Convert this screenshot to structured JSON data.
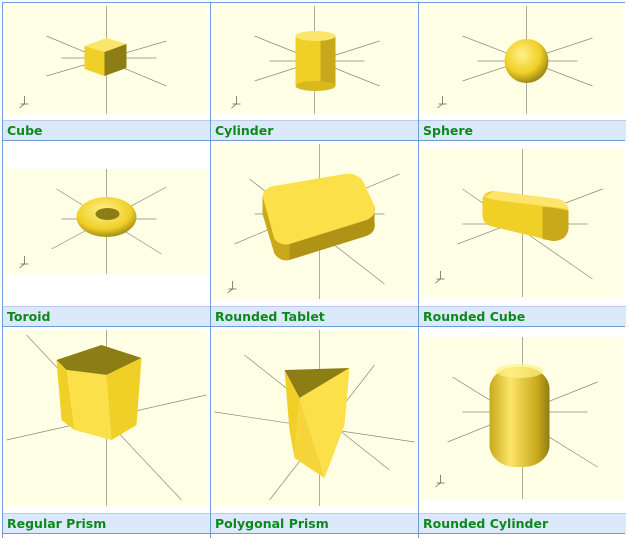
{
  "colors": {
    "border": "#6f9bd6",
    "label_bg": "#dbe9fb",
    "label_text": "#0b8a1b",
    "preview_bg": "#ffffe5",
    "shape": "#f5d53a"
  },
  "shapes": [
    {
      "label": "Cube",
      "icon": "cube-preview"
    },
    {
      "label": "Cylinder",
      "icon": "cylinder-preview"
    },
    {
      "label": "Sphere",
      "icon": "sphere-preview"
    },
    {
      "label": "Toroid",
      "icon": "toroid-preview"
    },
    {
      "label": "Rounded Tablet",
      "icon": "rounded-tablet-preview"
    },
    {
      "label": "Rounded Cube",
      "icon": "rounded-cube-preview"
    },
    {
      "label": "Regular Prism",
      "icon": "regular-prism-preview"
    },
    {
      "label": "Polygonal Prism",
      "icon": "polygonal-prism-preview"
    },
    {
      "label": "Rounded Cylinder",
      "icon": "rounded-cylinder-preview"
    }
  ]
}
